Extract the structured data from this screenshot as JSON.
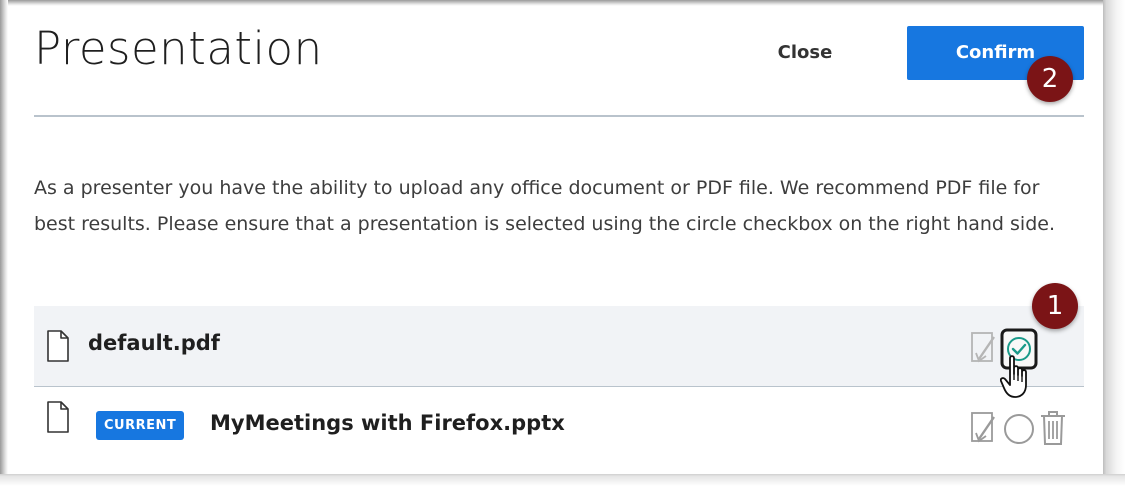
{
  "dialog": {
    "title": "Presentation",
    "close_label": "Close",
    "confirm_label": "Confirm",
    "description": "As a presenter you have the ability to upload any office document or PDF file. We recommend PDF file for best results. Please ensure that a presentation is selected using the circle checkbox on the right hand side."
  },
  "annotations": {
    "step_1": "1",
    "step_2": "2",
    "color": "#7b1416"
  },
  "files": [
    {
      "name": "default.pdf",
      "current": false,
      "selected": true,
      "icons": [
        "file-icon",
        "download-icon",
        "select-check-icon"
      ]
    },
    {
      "name": "MyMeetings with Firefox.pptx",
      "current": true,
      "tag": "CURRENT",
      "selected": false,
      "icons": [
        "file-icon",
        "download-icon",
        "select-circle-icon",
        "trash-icon"
      ]
    }
  ],
  "colors": {
    "primary": "#1777e0",
    "selected_check": "#1a9a8a",
    "divider": "#b9c3cc",
    "row_highlight": "#f1f3f6"
  }
}
